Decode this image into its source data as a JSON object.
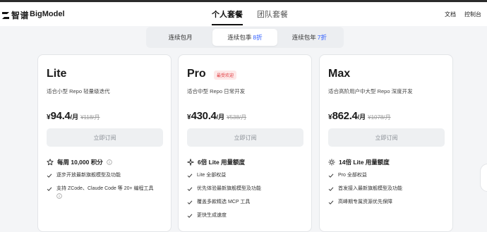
{
  "header": {
    "logo_cn": "智谱",
    "logo_en": "BigModel",
    "tabs": [
      {
        "label": "个人套餐",
        "active": true
      },
      {
        "label": "团队套餐",
        "active": false
      }
    ],
    "nav_right": [
      "文档",
      "控制台"
    ]
  },
  "billing": {
    "options": [
      {
        "label": "连续包月",
        "discount": "",
        "active": false
      },
      {
        "label": "连续包季",
        "discount": "8折",
        "active": true
      },
      {
        "label": "连续包年",
        "discount": "7折",
        "active": false
      }
    ]
  },
  "plans": [
    {
      "name": "Lite",
      "badge": "",
      "desc": "适合小型 Repo 轻量级迭代",
      "currency": "¥",
      "price": "94.4",
      "unit": "/月",
      "old_price": "¥118/月",
      "button": "立即订阅",
      "quota": "每周 10,000 积分",
      "quota_icon": "star-icon",
      "features": [
        "逐步开放最新旗舰模型及功能",
        "支持 ZCode、Claude Code 等 20+ 编程工具"
      ]
    },
    {
      "name": "Pro",
      "badge": "最受欢迎",
      "desc": "适合中型 Repo 日常开发",
      "currency": "¥",
      "price": "430.4",
      "unit": "/月",
      "old_price": "¥538/月",
      "button": "立即订阅",
      "quota": "6倍 Lite 用量额度",
      "quota_icon": "sparkle-icon",
      "features": [
        "Lite 全部权益",
        "优先体验最新旗舰模型及功能",
        "覆盖多款精选 MCP 工具",
        "更快生成速度"
      ]
    },
    {
      "name": "Max",
      "badge": "",
      "desc": "适合高阶用户中大型 Repo 深度开发",
      "currency": "¥",
      "price": "862.4",
      "unit": "/月",
      "old_price": "¥1078/月",
      "button": "立即订阅",
      "quota": "14倍 Lite 用量额度",
      "quota_icon": "sun-icon",
      "features": [
        "Pro 全部权益",
        "首发接入最新旗舰模型及功能",
        "高峰期专属资源优先保障"
      ]
    }
  ],
  "colors": {
    "accent": "#2f5dff",
    "badge_text": "#e0393e",
    "badge_bg": "#fde8e8"
  }
}
